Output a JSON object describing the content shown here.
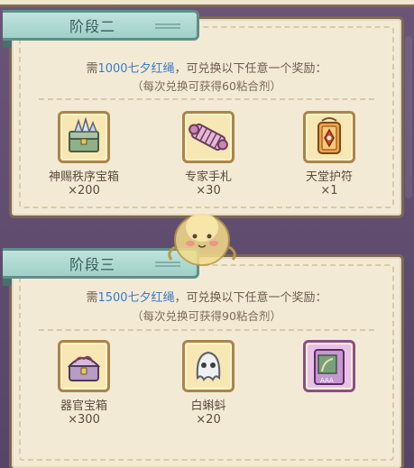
{
  "stages": [
    {
      "tab_label": "阶段二",
      "requirement": {
        "prefix": "需",
        "amount": "1000七夕红绳",
        "suffix": "，可兑换以下任意一个奖励："
      },
      "note": "（每次兑换可获得60粘合剂）",
      "rewards": [
        {
          "name": "神赐秩序宝箱",
          "qty": "×200",
          "icon": "crystal-chest-icon"
        },
        {
          "name": "专家手札",
          "qty": "×30",
          "icon": "scroll-icon"
        },
        {
          "name": "天堂护符",
          "qty": "×1",
          "icon": "charm-icon"
        }
      ]
    },
    {
      "tab_label": "阶段三",
      "requirement": {
        "prefix": "需",
        "amount": "1500七夕红绳",
        "suffix": "，可兑换以下任意一个奖励："
      },
      "note": "（每次兑换可获得90粘合剂）",
      "rewards": [
        {
          "name": "器官宝箱",
          "qty": "×300",
          "icon": "organ-chest-icon"
        },
        {
          "name": "白蝌蚪",
          "qty": "×20",
          "icon": "ghost-icon"
        },
        {
          "name": "",
          "qty": "",
          "icon": "card-icon"
        }
      ]
    }
  ],
  "colors": {
    "panel_bg": "#f3ead6",
    "tab_bg": "#9fd0c7",
    "highlight": "#3a7bc8",
    "slot_bg": "#f7e7b4"
  }
}
